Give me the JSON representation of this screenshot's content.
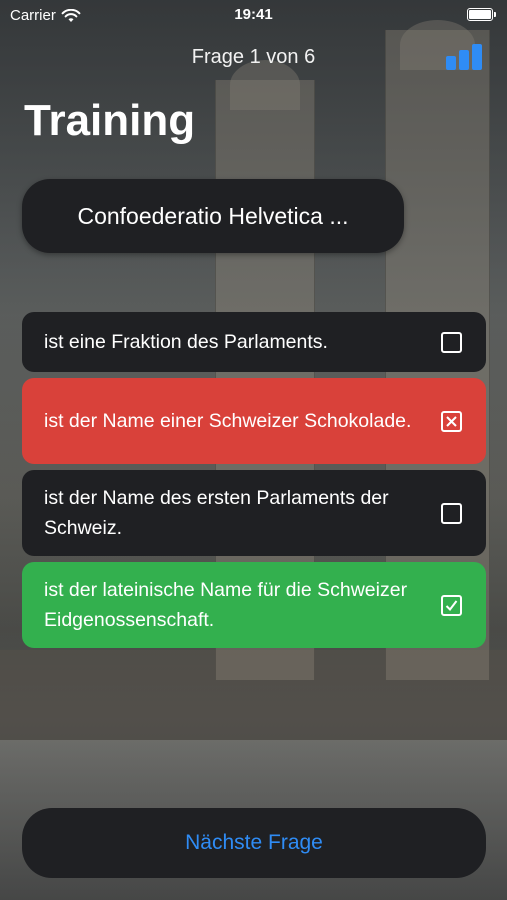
{
  "status_bar": {
    "carrier": "Carrier",
    "time": "19:41",
    "icons": [
      "wifi-icon",
      "battery-icon"
    ]
  },
  "nav": {
    "progress": "Frage 1 von 6",
    "stats_icon": "bar-chart-icon",
    "accent_color": "#2f8cf5"
  },
  "page": {
    "title": "Training"
  },
  "question": {
    "text": "Confoederatio Helvetica ..."
  },
  "answers": [
    {
      "text": "ist eine Fraktion des Parlaments.",
      "state": "neutral",
      "checkbox": "empty"
    },
    {
      "text": "ist der Name einer Schweizer Schokolade.",
      "state": "wrong",
      "checkbox": "crossed",
      "color": "#d9413a"
    },
    {
      "text": "ist der Name des ersten Parlaments der Schweiz.",
      "state": "neutral",
      "checkbox": "empty"
    },
    {
      "text": "ist der lateinische Name für die Schweizer Eidgenossenschaft.",
      "state": "correct",
      "checkbox": "checked",
      "color": "#33b04e"
    }
  ],
  "next_button": {
    "label": "Nächste Frage"
  }
}
